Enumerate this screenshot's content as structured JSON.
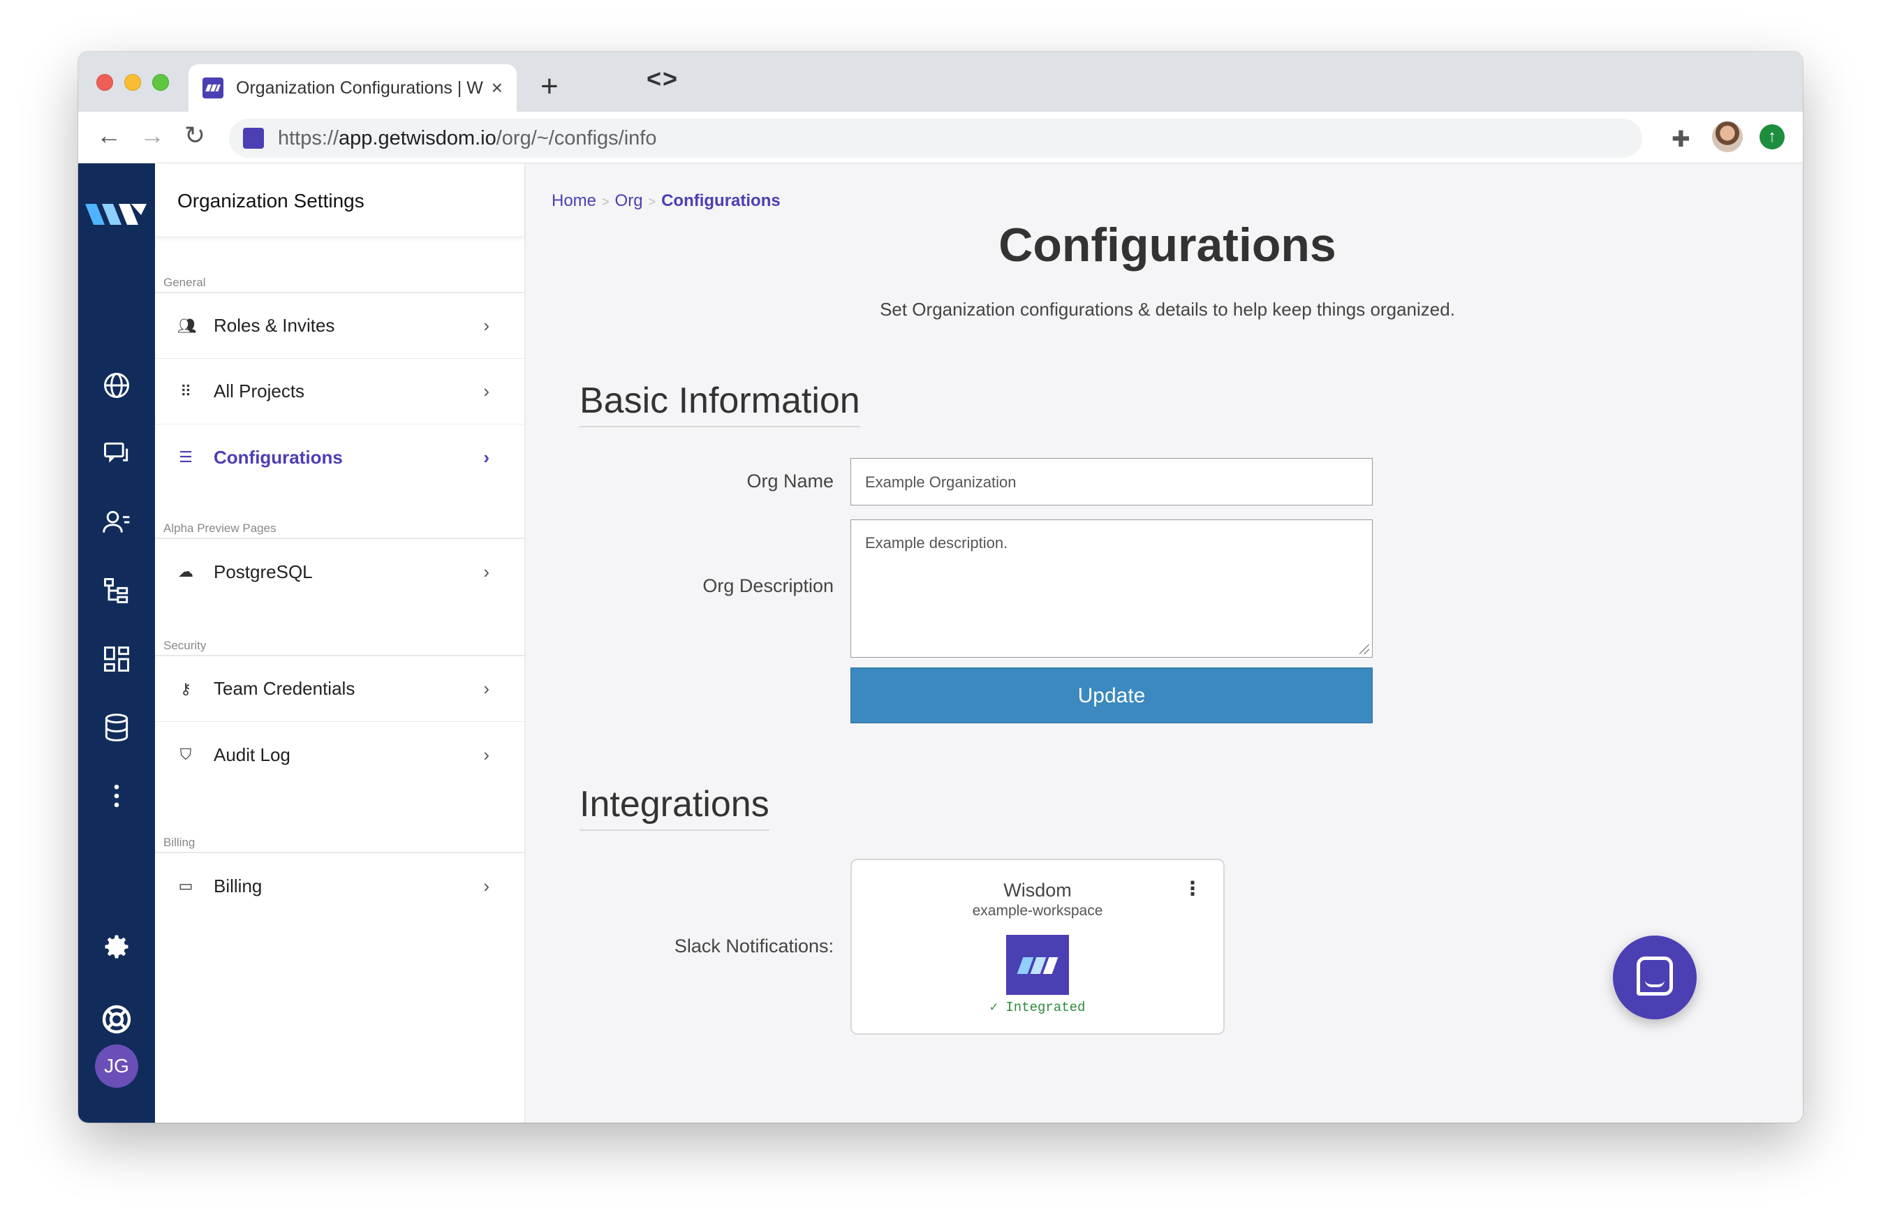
{
  "browser": {
    "tab_title": "Organization Configurations | W",
    "tab_close": "×",
    "new_tab": "+",
    "devtools": "<>",
    "url_prefix": "https://",
    "url_host": "app.getwisdom.io",
    "url_path": "/org/~/configs/info",
    "back": "←",
    "forward": "→",
    "reload": "↻"
  },
  "rail": {
    "icons": [
      "globe-icon",
      "chat-icon",
      "people-list-icon",
      "tree-icon",
      "dashboard-icon",
      "database-icon",
      "more-vertical-icon",
      "gear-icon",
      "lifebuoy-icon"
    ],
    "avatar_initials": "JG"
  },
  "settings_panel": {
    "title": "Organization Settings",
    "sections": {
      "general": "General",
      "alpha": "Alpha Preview Pages",
      "security": "Security",
      "billing": "Billing"
    },
    "items": {
      "roles": "Roles & Invites",
      "projects": "All Projects",
      "configurations": "Configurations",
      "postgres": "PostgreSQL",
      "credentials": "Team Credentials",
      "audit": "Audit Log",
      "billing": "Billing"
    },
    "chevron": "›"
  },
  "breadcrumb": {
    "home": "Home",
    "org": "Org",
    "current": "Configurations",
    "sep": ">"
  },
  "page": {
    "title": "Configurations",
    "subtitle": "Set Organization configurations & details to help keep things organized."
  },
  "basic_info": {
    "title": "Basic Information",
    "org_name_label": "Org Name",
    "org_name_value": "Example Organization",
    "org_desc_label": "Org Description",
    "org_desc_value": "Example description.",
    "update_label": "Update"
  },
  "integrations": {
    "title": "Integrations",
    "slack_label": "Slack Notifications:",
    "card": {
      "name": "Wisdom",
      "workspace": "example-workspace",
      "status": "✓ Integrated",
      "menu": "⋮"
    }
  },
  "colors": {
    "brand": "#4b3fb4",
    "rail": "#112c5a",
    "button": "#3b89bf",
    "success": "#2e8b3a"
  }
}
